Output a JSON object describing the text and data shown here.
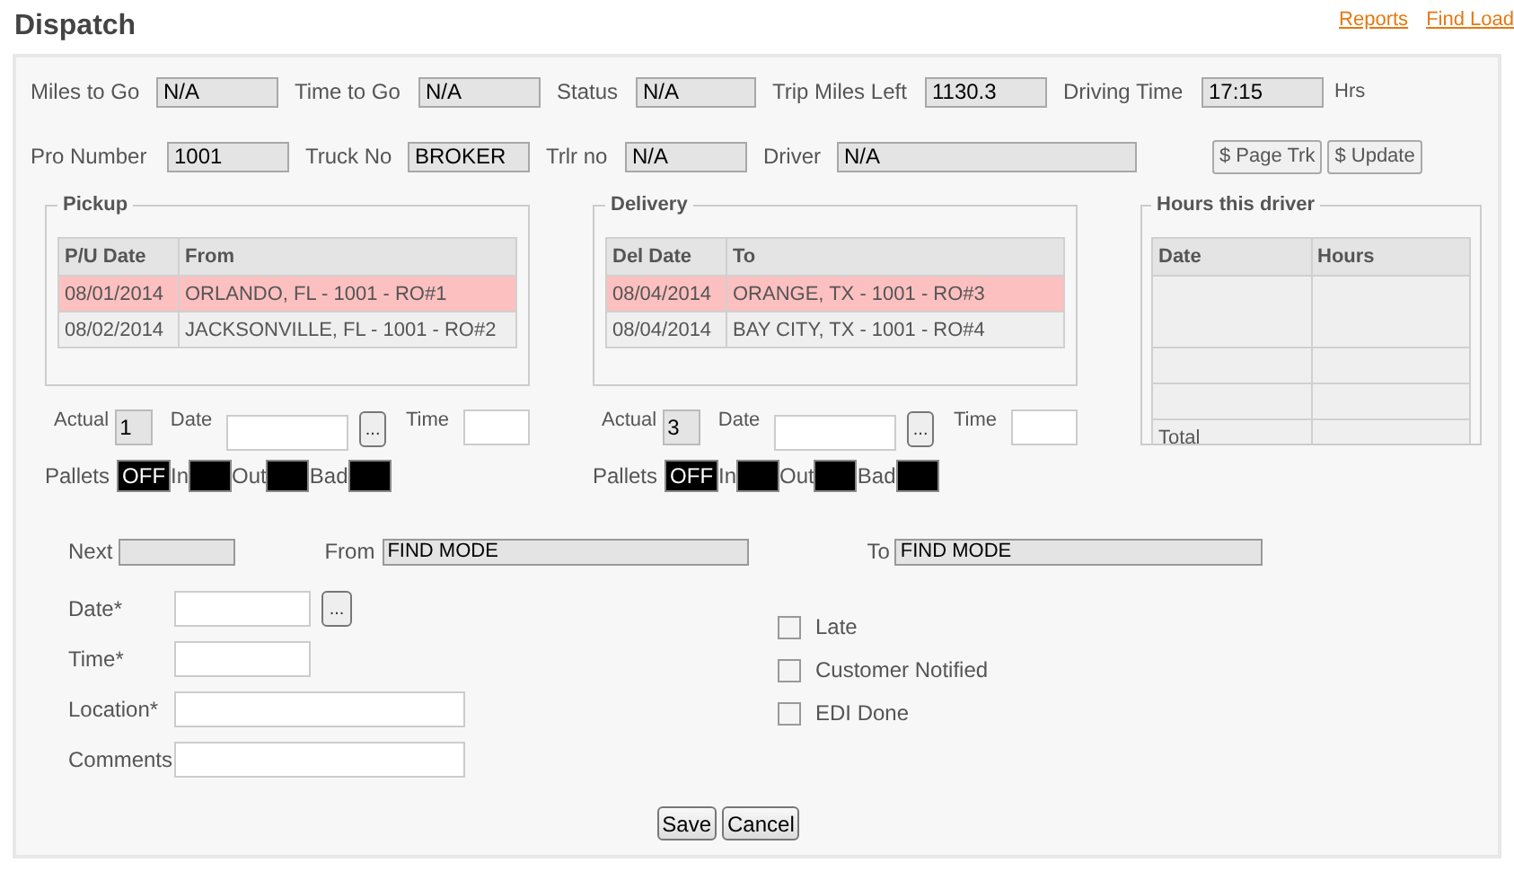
{
  "title": "Dispatch",
  "links": [
    "Reports",
    "Find Load"
  ],
  "summary_rows": [
    {
      "fields": [
        {
          "label": "Miles to Go",
          "value": "N/A"
        },
        {
          "label": "Time to Go",
          "value": "N/A"
        },
        {
          "label": "Status",
          "value": "N/A"
        },
        {
          "label": "Trip Miles Left",
          "value": "1130.3"
        },
        {
          "label": "Driving Time",
          "value": "17:15"
        }
      ],
      "unit": "Hrs"
    },
    {
      "fields": [
        {
          "label": "Pro Number",
          "value": "1001"
        },
        {
          "label": "Truck No",
          "value": "BROKER"
        },
        {
          "label": "Trlr no",
          "value": "N/A"
        },
        {
          "label": "Driver",
          "value": "N/A"
        }
      ],
      "buttons": [
        "$ Page Trk",
        "$ Update"
      ]
    }
  ],
  "stops": [
    {
      "legend": "Pickup",
      "columns": [
        "P/U Date",
        "From"
      ],
      "rows": [
        {
          "date": "08/01/2014",
          "place": "ORLANDO, FL - 1001 - RO#1",
          "selected": true
        },
        {
          "date": "08/02/2014",
          "place": "JACKSONVILLE, FL - 1001 - RO#2",
          "selected": false
        }
      ],
      "actual_label": "Actual",
      "actual": "1",
      "date_label": "Date",
      "picker": "...",
      "time_label": "Time",
      "pallets_label": "Pallets",
      "pallet_toggle": "OFF",
      "pallet_labels": [
        "In",
        "Out",
        "Bad"
      ]
    },
    {
      "legend": "Delivery",
      "columns": [
        "Del Date",
        "To"
      ],
      "rows": [
        {
          "date": "08/04/2014",
          "place": "ORANGE, TX - 1001 - RO#3",
          "selected": true
        },
        {
          "date": "08/04/2014",
          "place": "BAY CITY, TX - 1001 - RO#4",
          "selected": false
        }
      ],
      "actual_label": "Actual",
      "actual": "3",
      "date_label": "Date",
      "picker": "...",
      "time_label": "Time",
      "pallets_label": "Pallets",
      "pallet_toggle": "OFF",
      "pallet_labels": [
        "In",
        "Out",
        "Bad"
      ]
    }
  ],
  "hours": {
    "legend": "Hours this driver",
    "columns": [
      "Date",
      "Hours"
    ],
    "total_label": "Total"
  },
  "next": {
    "label": "Next",
    "from_label": "From",
    "from_value": "FIND MODE",
    "to_label": "To",
    "to_value": "FIND MODE"
  },
  "form_fields": [
    {
      "label": "Date*",
      "picker": "..."
    },
    {
      "label": "Time*"
    },
    {
      "label": "Location*"
    },
    {
      "label": "Comments"
    }
  ],
  "checkboxes": [
    {
      "label": "Late",
      "checked": false
    },
    {
      "label": "Customer Notified",
      "checked": false
    },
    {
      "label": "EDI Done",
      "checked": false
    }
  ],
  "buttons": [
    "Save",
    "Cancel"
  ]
}
